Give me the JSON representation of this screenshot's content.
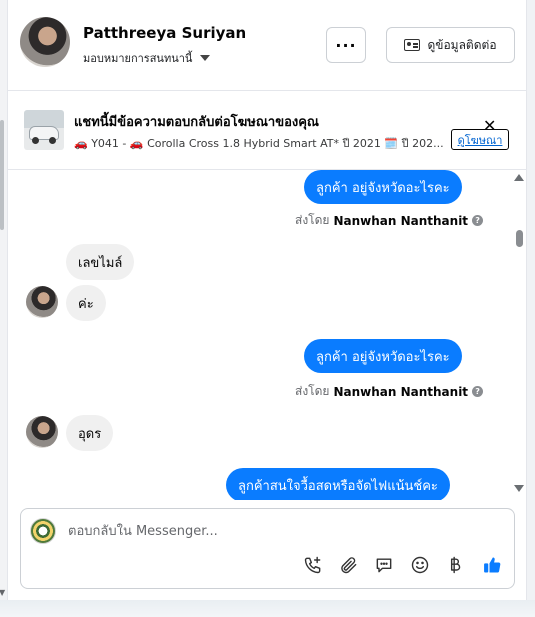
{
  "contact": {
    "name": "Patthreeya Suriyan",
    "assign_label": "มอบหมายการสนทนานี้"
  },
  "header": {
    "more_label": "···",
    "contact_info_label": "ดูข้อมูลติดต่อ"
  },
  "ad": {
    "title": "แชทนี้มีข้อความตอบกลับต่อโฆษณาของคุณ",
    "detail": "🚗 Y041 - 🚗 Corolla Cross 1.8 Hybrid Smart AT* ปี 2021 🗓️ ปี 202...",
    "view_ad_label": "ดูโฆษณา",
    "close_label": "✕"
  },
  "messages": {
    "out_1": "ลูกค้า อยู่จังหวัดอะไรคะ",
    "sent_by_prefix": "ส่งโดย",
    "agent_name": "Nanwhan Nanthanit",
    "in_1": "เลขไมล์",
    "in_2": "ค่ะ",
    "out_2": "ลูกค้า อยู่จังหวัดอะไรคะ",
    "in_3": "อุดร",
    "out_3": "ลูกค้าสนใจวื้อสดหรือจัดไฟแน้นช์คะ"
  },
  "composer": {
    "placeholder": "ตอบกลับใน Messenger..."
  },
  "icons": {
    "call": "phone-plus-icon",
    "attach": "paperclip-icon",
    "saved_replies": "chat-bubble-icon",
    "emoji": "smiley-icon",
    "payment": "baht-icon",
    "like": "thumbs-up-icon"
  },
  "colors": {
    "bubble_out": "#0a7cff",
    "bubble_in": "#f0f0f0",
    "like": "#0a7cff"
  }
}
